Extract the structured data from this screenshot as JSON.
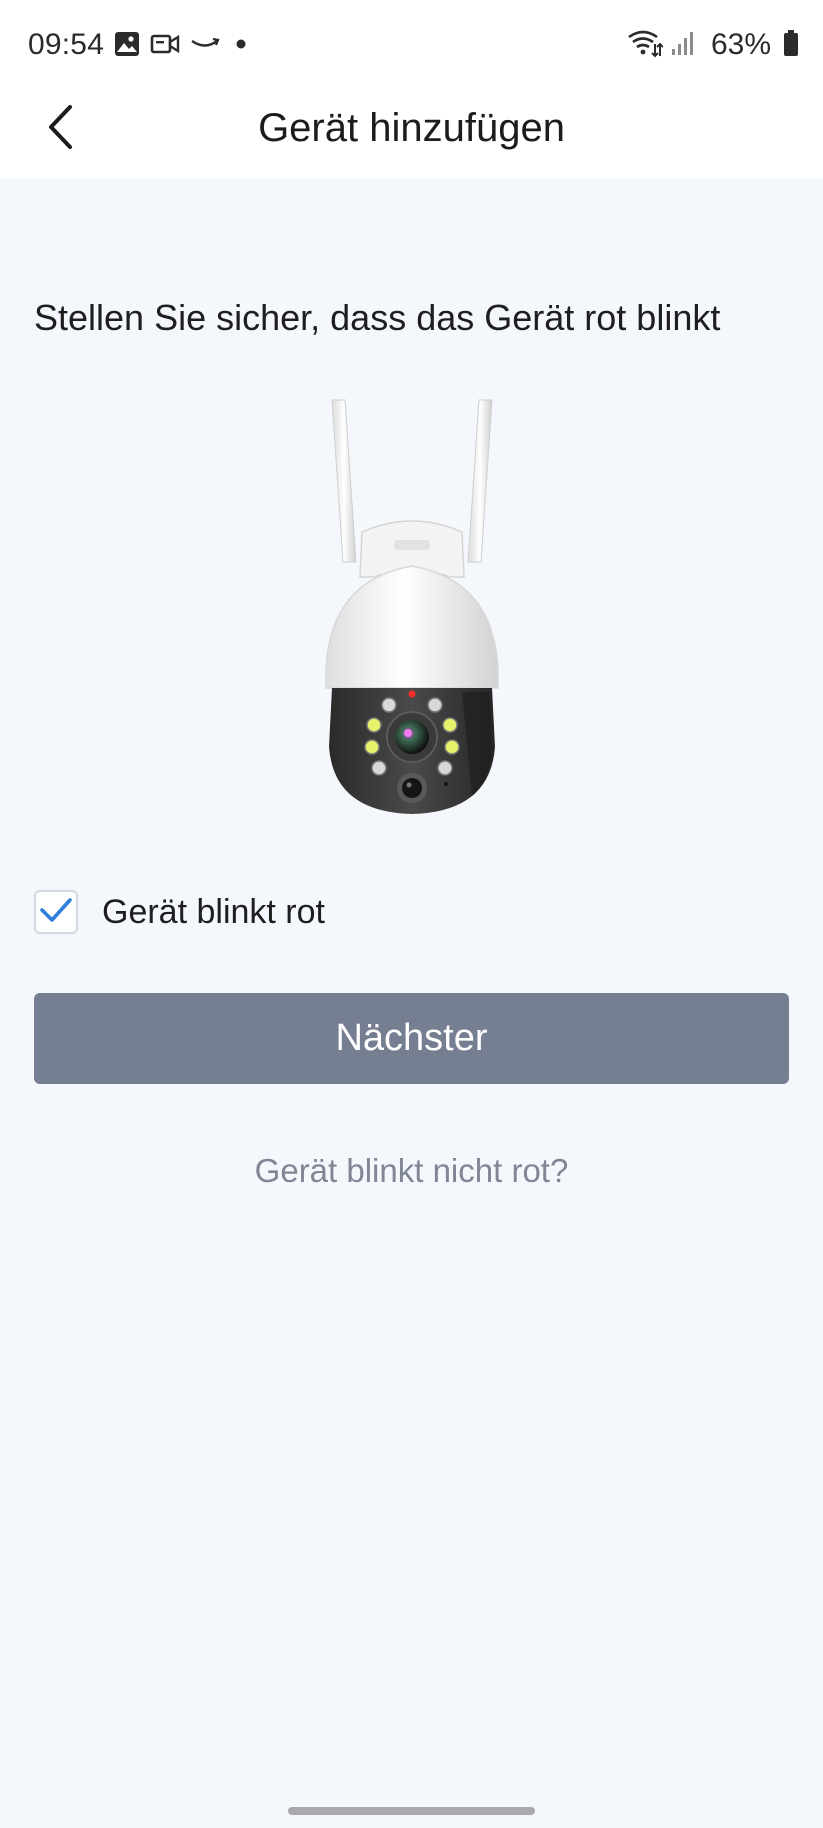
{
  "status_bar": {
    "time": "09:54",
    "notification_icons": [
      "gallery-icon",
      "video-call-icon",
      "amazon-icon",
      "dot-icon"
    ],
    "system_icons": [
      "wifi-icon",
      "signal-icon",
      "battery-icon"
    ],
    "battery": "63%"
  },
  "header": {
    "title": "Gerät hinzufügen"
  },
  "main": {
    "instruction": "Stellen Sie sicher, dass das Gerät rot blinkt",
    "device_image": "security-camera-illustration",
    "checkbox": {
      "label": "Gerät blinkt rot",
      "checked": true
    },
    "next_label": "Nächster",
    "help_link": "Gerät blinkt nicht rot?"
  },
  "colors": {
    "background": "#f4f7fc",
    "button": "#767e91",
    "check": "#2f7fd8",
    "link": "#7f8796"
  }
}
